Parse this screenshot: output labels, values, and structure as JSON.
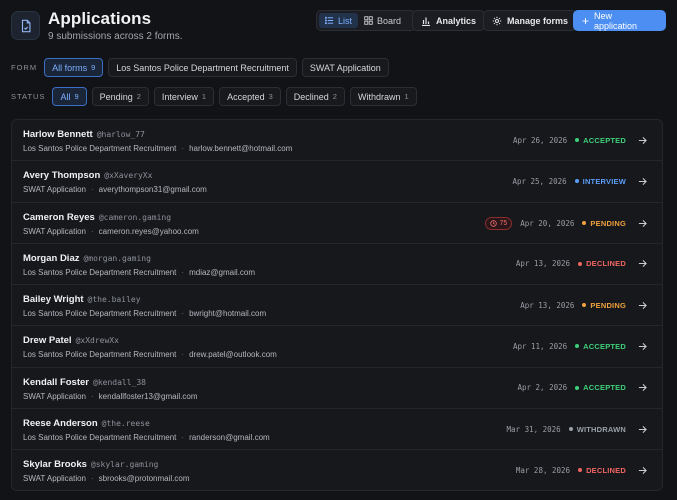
{
  "header": {
    "title": "Applications",
    "subtitle": "9 submissions across 2 forms.",
    "app_icon": "document-icon"
  },
  "view_toggle": {
    "list_label": "List",
    "board_label": "Board",
    "selected": "List"
  },
  "actions": {
    "analytics_label": "Analytics",
    "manage_label": "Manage forms",
    "new_label": "New application"
  },
  "form_filter": {
    "label": "FORM",
    "options": [
      {
        "label": "All forms",
        "count": "9"
      },
      {
        "label": "Los Santos Police Department Recruitment",
        "count": ""
      },
      {
        "label": "SWAT Application",
        "count": ""
      }
    ],
    "selected": "All forms"
  },
  "status_filter": {
    "label": "STATUS",
    "options": [
      {
        "label": "All",
        "count": "9"
      },
      {
        "label": "Pending",
        "count": "2"
      },
      {
        "label": "Interview",
        "count": "1"
      },
      {
        "label": "Accepted",
        "count": "3"
      },
      {
        "label": "Declined",
        "count": "2"
      },
      {
        "label": "Withdrawn",
        "count": "1"
      }
    ],
    "selected": "All"
  },
  "status_colors": {
    "ACCEPTED": "#3ecf7a",
    "INTERVIEW": "#5b9cf6",
    "PENDING": "#f0a03c",
    "DECLINED": "#f06562",
    "WITHDRAWN": "#9aa0a8"
  },
  "applications": [
    {
      "name": "Harlow Bennett",
      "handle": "@harlow_77",
      "form": "Los Santos Police Department Recruitment",
      "email": "harlow.bennett@hotmail.com",
      "date": "Apr 26, 2026",
      "status": "ACCEPTED",
      "flag": ""
    },
    {
      "name": "Avery Thompson",
      "handle": "@xXaveryXx",
      "form": "SWAT Application",
      "email": "averythompson31@gmail.com",
      "date": "Apr 25, 2026",
      "status": "INTERVIEW",
      "flag": ""
    },
    {
      "name": "Cameron Reyes",
      "handle": "@cameron.gaming",
      "form": "SWAT Application",
      "email": "cameron.reyes@yahoo.com",
      "date": "Apr 20, 2026",
      "status": "PENDING",
      "flag": "75"
    },
    {
      "name": "Morgan Diaz",
      "handle": "@morgan.gaming",
      "form": "Los Santos Police Department Recruitment",
      "email": "mdiaz@gmail.com",
      "date": "Apr 13, 2026",
      "status": "DECLINED",
      "flag": ""
    },
    {
      "name": "Bailey Wright",
      "handle": "@the.bailey",
      "form": "Los Santos Police Department Recruitment",
      "email": "bwright@hotmail.com",
      "date": "Apr 13, 2026",
      "status": "PENDING",
      "flag": ""
    },
    {
      "name": "Drew Patel",
      "handle": "@xXdrewXx",
      "form": "Los Santos Police Department Recruitment",
      "email": "drew.patel@outlook.com",
      "date": "Apr 11, 2026",
      "status": "ACCEPTED",
      "flag": ""
    },
    {
      "name": "Kendall Foster",
      "handle": "@kendall_38",
      "form": "SWAT Application",
      "email": "kendallfoster13@gmail.com",
      "date": "Apr 2, 2026",
      "status": "ACCEPTED",
      "flag": ""
    },
    {
      "name": "Reese Anderson",
      "handle": "@the.reese",
      "form": "Los Santos Police Department Recruitment",
      "email": "randerson@gmail.com",
      "date": "Mar 31, 2026",
      "status": "WITHDRAWN",
      "flag": ""
    },
    {
      "name": "Skylar Brooks",
      "handle": "@skylar.gaming",
      "form": "SWAT Application",
      "email": "sbrooks@protonmail.com",
      "date": "Mar 28, 2026",
      "status": "DECLINED",
      "flag": ""
    }
  ]
}
